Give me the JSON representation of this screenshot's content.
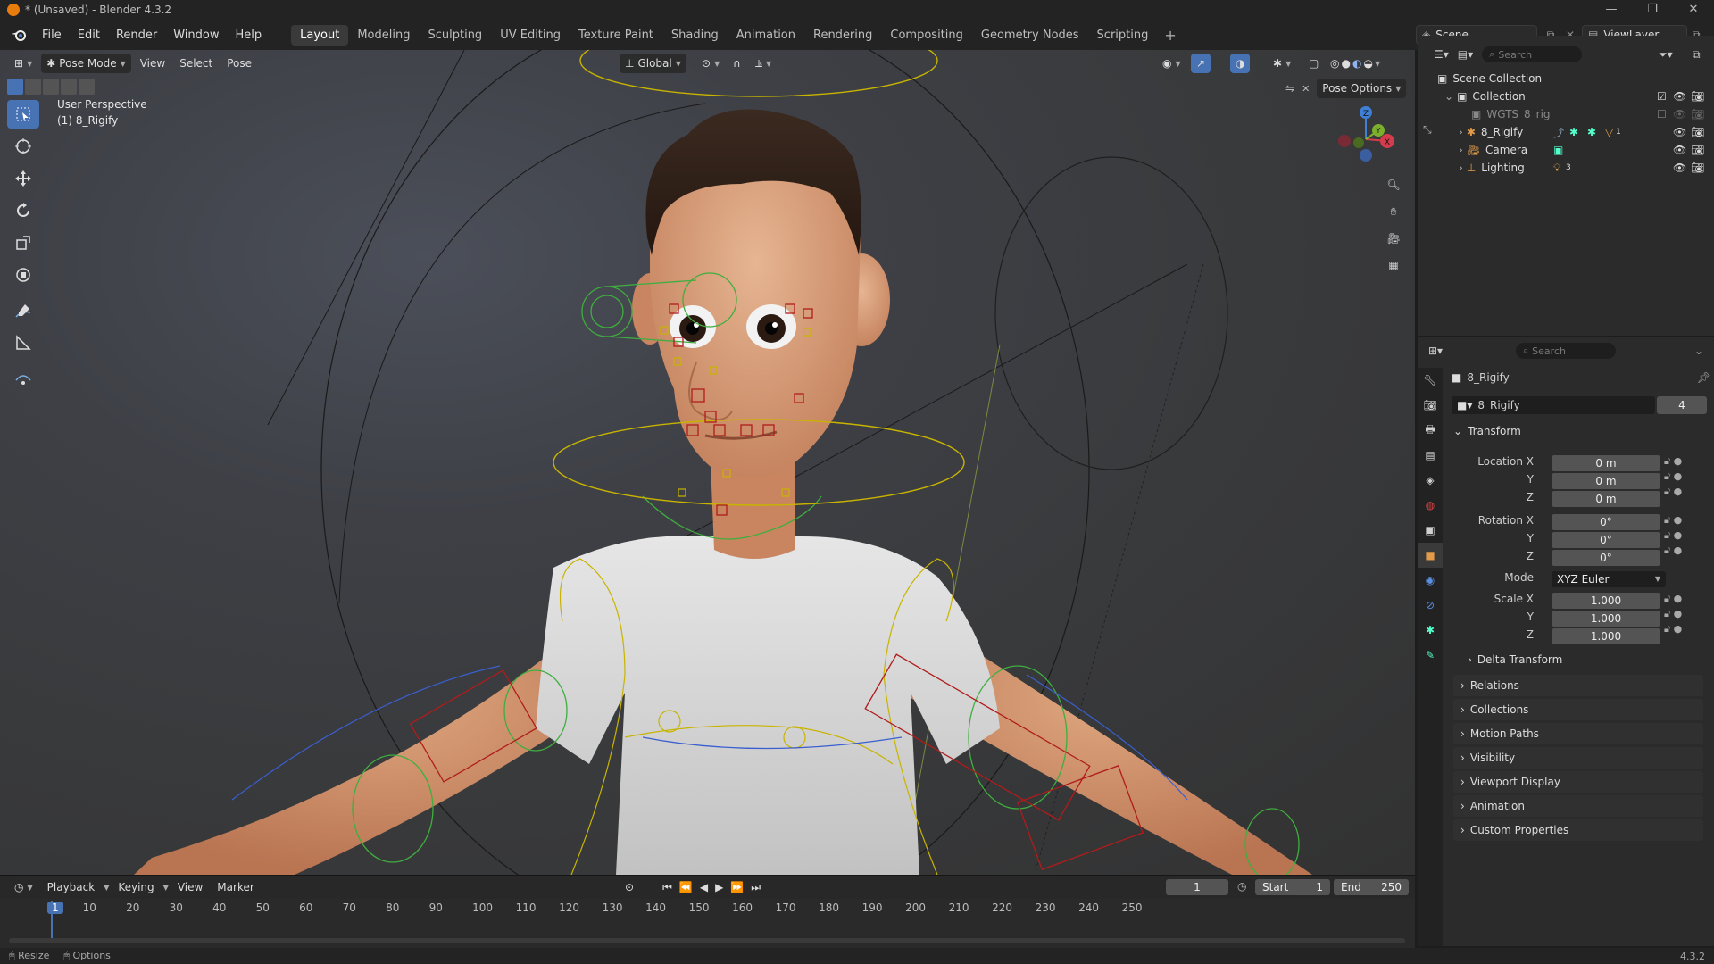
{
  "titlebar": {
    "title": "* (Unsaved) - Blender 4.3.2"
  },
  "menus": [
    "File",
    "Edit",
    "Render",
    "Window",
    "Help"
  ],
  "workspaces": [
    "Layout",
    "Modeling",
    "Sculpting",
    "UV Editing",
    "Texture Paint",
    "Shading",
    "Animation",
    "Rendering",
    "Compositing",
    "Geometry Nodes",
    "Scripting"
  ],
  "scene": {
    "name": "Scene",
    "view_layer": "ViewLayer"
  },
  "viewport": {
    "mode": "Pose Mode",
    "menus": [
      "View",
      "Select",
      "Pose"
    ],
    "orientation": "Global",
    "pose_options": "Pose Options",
    "overlay_line1": "User Perspective",
    "overlay_line2": "(1) 8_Rigify",
    "gizmo_axes": {
      "x": "X",
      "y": "Y",
      "z": "Z"
    }
  },
  "outliner": {
    "search_placeholder": "Search",
    "scene_collection": "Scene Collection",
    "collection": "Collection",
    "items": [
      "WGTS_8_rig",
      "8_Rigify",
      "Camera",
      "Lighting"
    ],
    "rig_badge": "1",
    "lighting_badge": "3"
  },
  "properties": {
    "search_placeholder": "Search",
    "object_name": "8_Rigify",
    "data_name": "8_Rigify",
    "users": "4",
    "transform_label": "Transform",
    "location_label": "Location X",
    "rotation_label": "Rotation X",
    "scale_label": "Scale X",
    "y_label": "Y",
    "z_label": "Z",
    "location": [
      "0 m",
      "0 m",
      "0 m"
    ],
    "rotation": [
      "0°",
      "0°",
      "0°"
    ],
    "mode_label": "Mode",
    "mode_value": "XYZ Euler",
    "scale": [
      "1.000",
      "1.000",
      "1.000"
    ],
    "delta_transform": "Delta Transform",
    "panels": [
      "Relations",
      "Collections",
      "Motion Paths",
      "Visibility",
      "Viewport Display",
      "Animation",
      "Custom Properties"
    ]
  },
  "timeline": {
    "menus": [
      "Playback",
      "Keying",
      "View",
      "Marker"
    ],
    "current_frame": "1",
    "start_label": "Start",
    "start": "1",
    "end_label": "End",
    "end": "250",
    "ruler": [
      "1",
      "10",
      "20",
      "30",
      "40",
      "50",
      "60",
      "70",
      "80",
      "90",
      "100",
      "110",
      "120",
      "130",
      "140",
      "150",
      "160",
      "170",
      "180",
      "190",
      "200",
      "210",
      "220",
      "230",
      "240",
      "250"
    ]
  },
  "statusbar": {
    "resize": "Resize",
    "options": "Options",
    "version": "4.3.2"
  }
}
